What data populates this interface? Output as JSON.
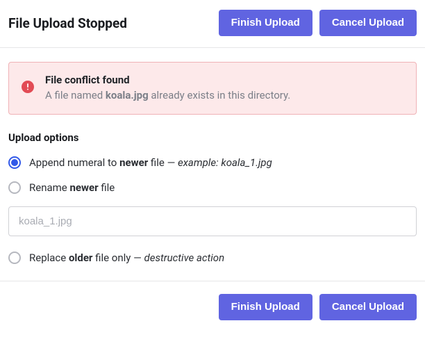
{
  "dialog": {
    "title": "File Upload Stopped",
    "finish_label": "Finish Upload",
    "cancel_label": "Cancel Upload"
  },
  "alert": {
    "icon": "warning-icon",
    "title": "File conflict found",
    "desc_prefix": "A file named ",
    "desc_filename": "koala.jpg",
    "desc_suffix": " already exists in this directory."
  },
  "upload_options": {
    "section_label": "Upload options",
    "items": [
      {
        "selected": true,
        "pre": "Append numeral to ",
        "bold": "newer",
        "mid": " file ",
        "dash": "— ",
        "italic": "example: koala_1.jpg"
      },
      {
        "selected": false,
        "pre": "Rename ",
        "bold": "newer",
        "mid": " file",
        "dash": "",
        "italic": ""
      },
      {
        "selected": false,
        "pre": "Replace ",
        "bold": "older",
        "mid": " file only ",
        "dash": "— ",
        "italic": "destructive action"
      }
    ]
  },
  "rename_input": {
    "placeholder": "koala_1.jpg",
    "value": ""
  },
  "colors": {
    "primary_button": "#6064e1",
    "alert_bg": "#fde9ea",
    "alert_border": "#f0b2b6",
    "alert_icon": "#e24b55",
    "radio_selected": "#3259e8"
  }
}
